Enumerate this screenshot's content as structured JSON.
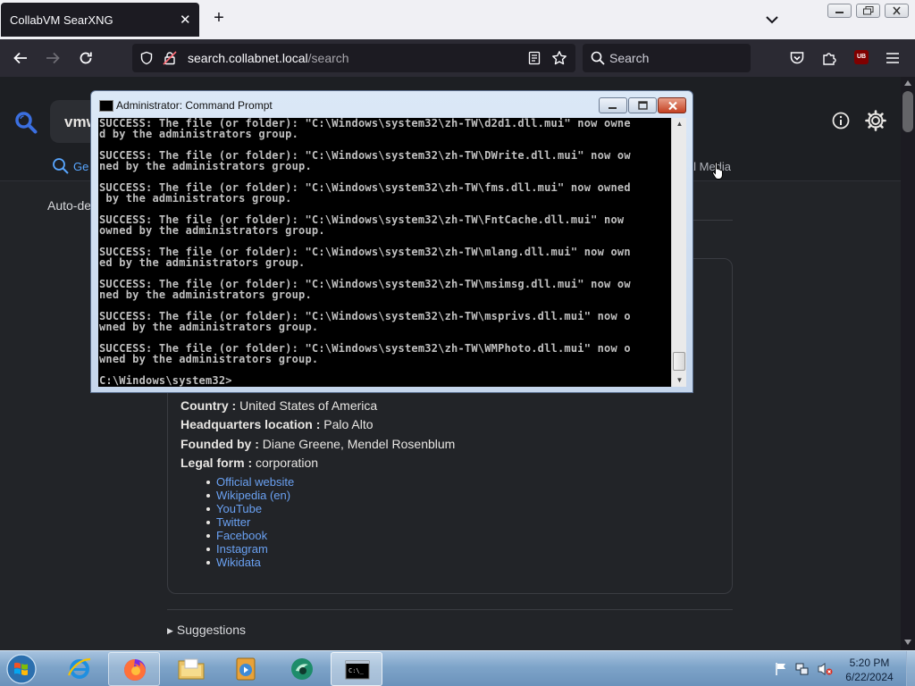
{
  "browser": {
    "tab_title": "CollabVM SearXNG",
    "url_domain": "search.collabnet.local",
    "url_path": "/search",
    "search_placeholder": "Search",
    "ublock_badge": "UB"
  },
  "page": {
    "query_partial": "vmw",
    "tab_general": "Ge",
    "tab_social": "ial Media",
    "autodetect": "Auto-det",
    "infobox": {
      "country_label": "Country :",
      "country_value": "United States of America",
      "hq_label": "Headquarters location :",
      "hq_value": "Palo Alto",
      "founded_label": "Founded by :",
      "founded_value": "Diane Greene, Mendel Rosenblum",
      "legal_label": "Legal form :",
      "legal_value": "corporation",
      "links": [
        "Official website",
        "Wikipedia (en)",
        "YouTube",
        "Twitter",
        "Facebook",
        "Instagram",
        "Wikidata"
      ]
    },
    "suggestions": "Suggestions"
  },
  "cmd": {
    "title": "Administrator: Command Prompt",
    "output": "SUCCESS: The file (or folder): \"C:\\Windows\\system32\\zh-TW\\d2d1.dll.mui\" now owne\nd by the administrators group.\n\nSUCCESS: The file (or folder): \"C:\\Windows\\system32\\zh-TW\\DWrite.dll.mui\" now ow\nned by the administrators group.\n\nSUCCESS: The file (or folder): \"C:\\Windows\\system32\\zh-TW\\fms.dll.mui\" now owned\n by the administrators group.\n\nSUCCESS: The file (or folder): \"C:\\Windows\\system32\\zh-TW\\FntCache.dll.mui\" now\nowned by the administrators group.\n\nSUCCESS: The file (or folder): \"C:\\Windows\\system32\\zh-TW\\mlang.dll.mui\" now own\ned by the administrators group.\n\nSUCCESS: The file (or folder): \"C:\\Windows\\system32\\zh-TW\\msimsg.dll.mui\" now ow\nned by the administrators group.\n\nSUCCESS: The file (or folder): \"C:\\Windows\\system32\\zh-TW\\msprivs.dll.mui\" now o\nwned by the administrators group.\n\nSUCCESS: The file (or folder): \"C:\\Windows\\system32\\zh-TW\\WMPhoto.dll.mui\" now o\nwned by the administrators group.\n\nC:\\Windows\\system32>"
  },
  "taskbar": {
    "time": "5:20 PM",
    "date": "6/22/2024",
    "cmd_icon_text": "C:\\_"
  },
  "colors": {
    "accent": "#58a6ff",
    "link": "#6aa1f2",
    "page_bg": "#222428"
  }
}
